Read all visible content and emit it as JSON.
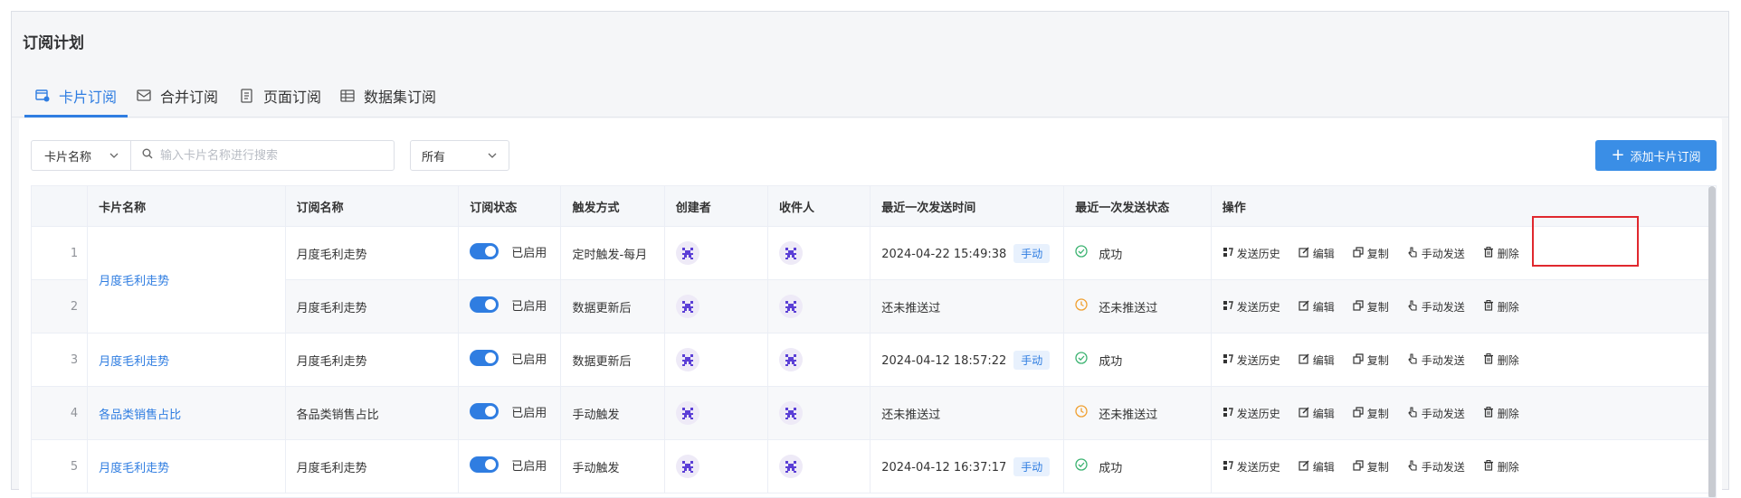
{
  "page": {
    "title": "订阅计划"
  },
  "tabs": [
    {
      "label": "卡片订阅",
      "icon": "card-subscribe-icon",
      "active": true
    },
    {
      "label": "合并订阅",
      "icon": "merge-subscribe-icon"
    },
    {
      "label": "页面订阅",
      "icon": "page-subscribe-icon"
    },
    {
      "label": "数据集订阅",
      "icon": "dataset-subscribe-icon"
    }
  ],
  "filters": {
    "field_select": "卡片名称",
    "search_placeholder": "输入卡片名称进行搜索",
    "status_select": "所有"
  },
  "add_button": "添加卡片订阅",
  "table": {
    "headers": [
      "卡片名称",
      "订阅名称",
      "订阅状态",
      "触发方式",
      "创建者",
      "收件人",
      "最近一次发送时间",
      "最近一次发送状态",
      "操作"
    ],
    "rows": [
      {
        "index": "1",
        "card": "月度毛利走势",
        "sub": "月度毛利走势",
        "enabled": "已启用",
        "trigger": "定时触发-每月",
        "time": "2024-04-22 15:49:38",
        "tag": "手动",
        "status": "成功"
      },
      {
        "index": "2",
        "card": "",
        "sub": "月度毛利走势",
        "enabled": "已启用",
        "trigger": "数据更新后",
        "time": "还未推送过",
        "tag": "",
        "status": "还未推送过"
      },
      {
        "index": "3",
        "card": "月度毛利走势",
        "sub": "月度毛利走势",
        "enabled": "已启用",
        "trigger": "数据更新后",
        "time": "2024-04-12 18:57:22",
        "tag": "手动",
        "status": "成功"
      },
      {
        "index": "4",
        "card": "各品类销售占比",
        "sub": "各品类销售占比",
        "enabled": "已启用",
        "trigger": "手动触发",
        "time": "还未推送过",
        "tag": "",
        "status": "还未推送过"
      },
      {
        "index": "5",
        "card": "月度毛利走势",
        "sub": "月度毛利走势",
        "enabled": "已启用",
        "trigger": "手动触发",
        "time": "2024-04-12 16:37:17",
        "tag": "手动",
        "status": "成功"
      }
    ],
    "actions": [
      "发送历史",
      "编辑",
      "复制",
      "手动发送",
      "删除"
    ]
  },
  "colors": {
    "primary": "#2f7de1",
    "success": "#3cb371",
    "pending": "#f0a030",
    "highlight": "#e0282e"
  }
}
